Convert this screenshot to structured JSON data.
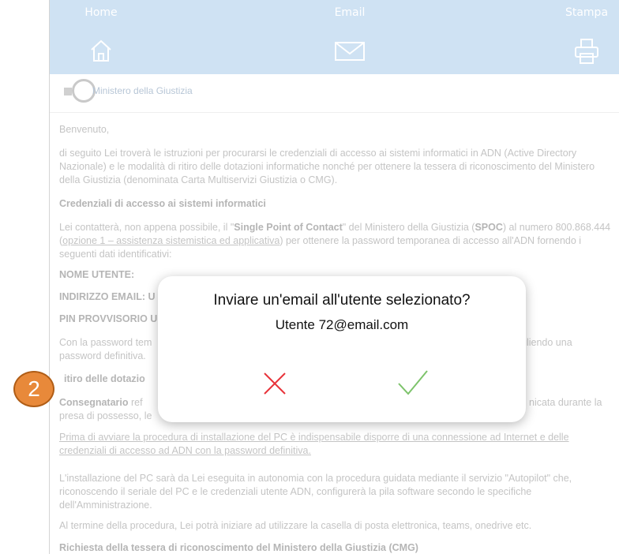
{
  "toolbar": {
    "home_label": "Home",
    "email_label": "Email",
    "print_label": "Stampa"
  },
  "logo": {
    "text": "Ministero della Giustizia"
  },
  "content": {
    "greeting": "Benvenuto,",
    "intro": "di seguito Lei troverà le istruzioni per procurarsi le credenziali di accesso ai sistemi informatici in ADN (Active Directory Nazionale) e le modalità di ritiro delle dotazioni informatiche nonché per ottenere la tessera di riconoscimento del Ministero della Giustizia (denominata Carta Multiservizi Giustizia o CMG).",
    "h_credentials": "Credenziali di accesso ai sistemi informatici",
    "spoc_a": "Lei contatterà, non appena possibile, il \"",
    "spoc_b": "Single Point of Contact",
    "spoc_c": "\" del Ministero della Giustizia (",
    "spoc_d": "SPOC",
    "spoc_e": ") al numero 800.868.444 (",
    "spoc_f": "opzione 1 – assistenza sistemistica ed applicativa",
    "spoc_g": ") per ottenere la password temporanea di accesso all'ADN fornendo i seguenti dati identificativi:",
    "nome_utente": "NOME UTENTE:",
    "indirizzo_email": "INDIRIZZO EMAIL: U",
    "pin": "PIN PROVVISORIO U",
    "password_a": "Con la password tem",
    "password_b": "gliendo una",
    "password_c": "password definitiva.",
    "ritiro": "itiro delle dotazio",
    "consegnatario": "Consegnatario",
    "consegnatario_rest": " ref",
    "consegnatario_end": "nicata durante la",
    "presa": "presa di possesso, le",
    "prima": "Prima di avviare la procedura di installazione del PC è indispensabile disporre di una connessione ad Internet e delle credenziali di accesso ad ADN con la password definitiva.",
    "installazione": "L'installazione del PC sarà da Lei eseguita in autonomia con la procedura guidata mediante il servizio \"Autopilot\" che, riconoscendo il seriale del PC e le credenziali utente ADN, configurerà la pila software secondo le specifiche dell'Amministrazione.",
    "termine": "Al termine della procedura, Lei potrà iniziare ad utilizzare la casella di posta elettronica, teams, onedrive etc.",
    "h_cmg": "Richiesta della tessera di riconoscimento del Ministero della Giustizia (CMG)"
  },
  "dialog": {
    "question": "Inviare un'email all'utente selezionato?",
    "user": "Utente 72@email.com",
    "cancel_color": "#e8333a",
    "confirm_color": "#7dc36b"
  },
  "badge": {
    "number": "2",
    "color": "#e8893a"
  },
  "colors": {
    "toolbar_bg": "#cfe2f3"
  }
}
